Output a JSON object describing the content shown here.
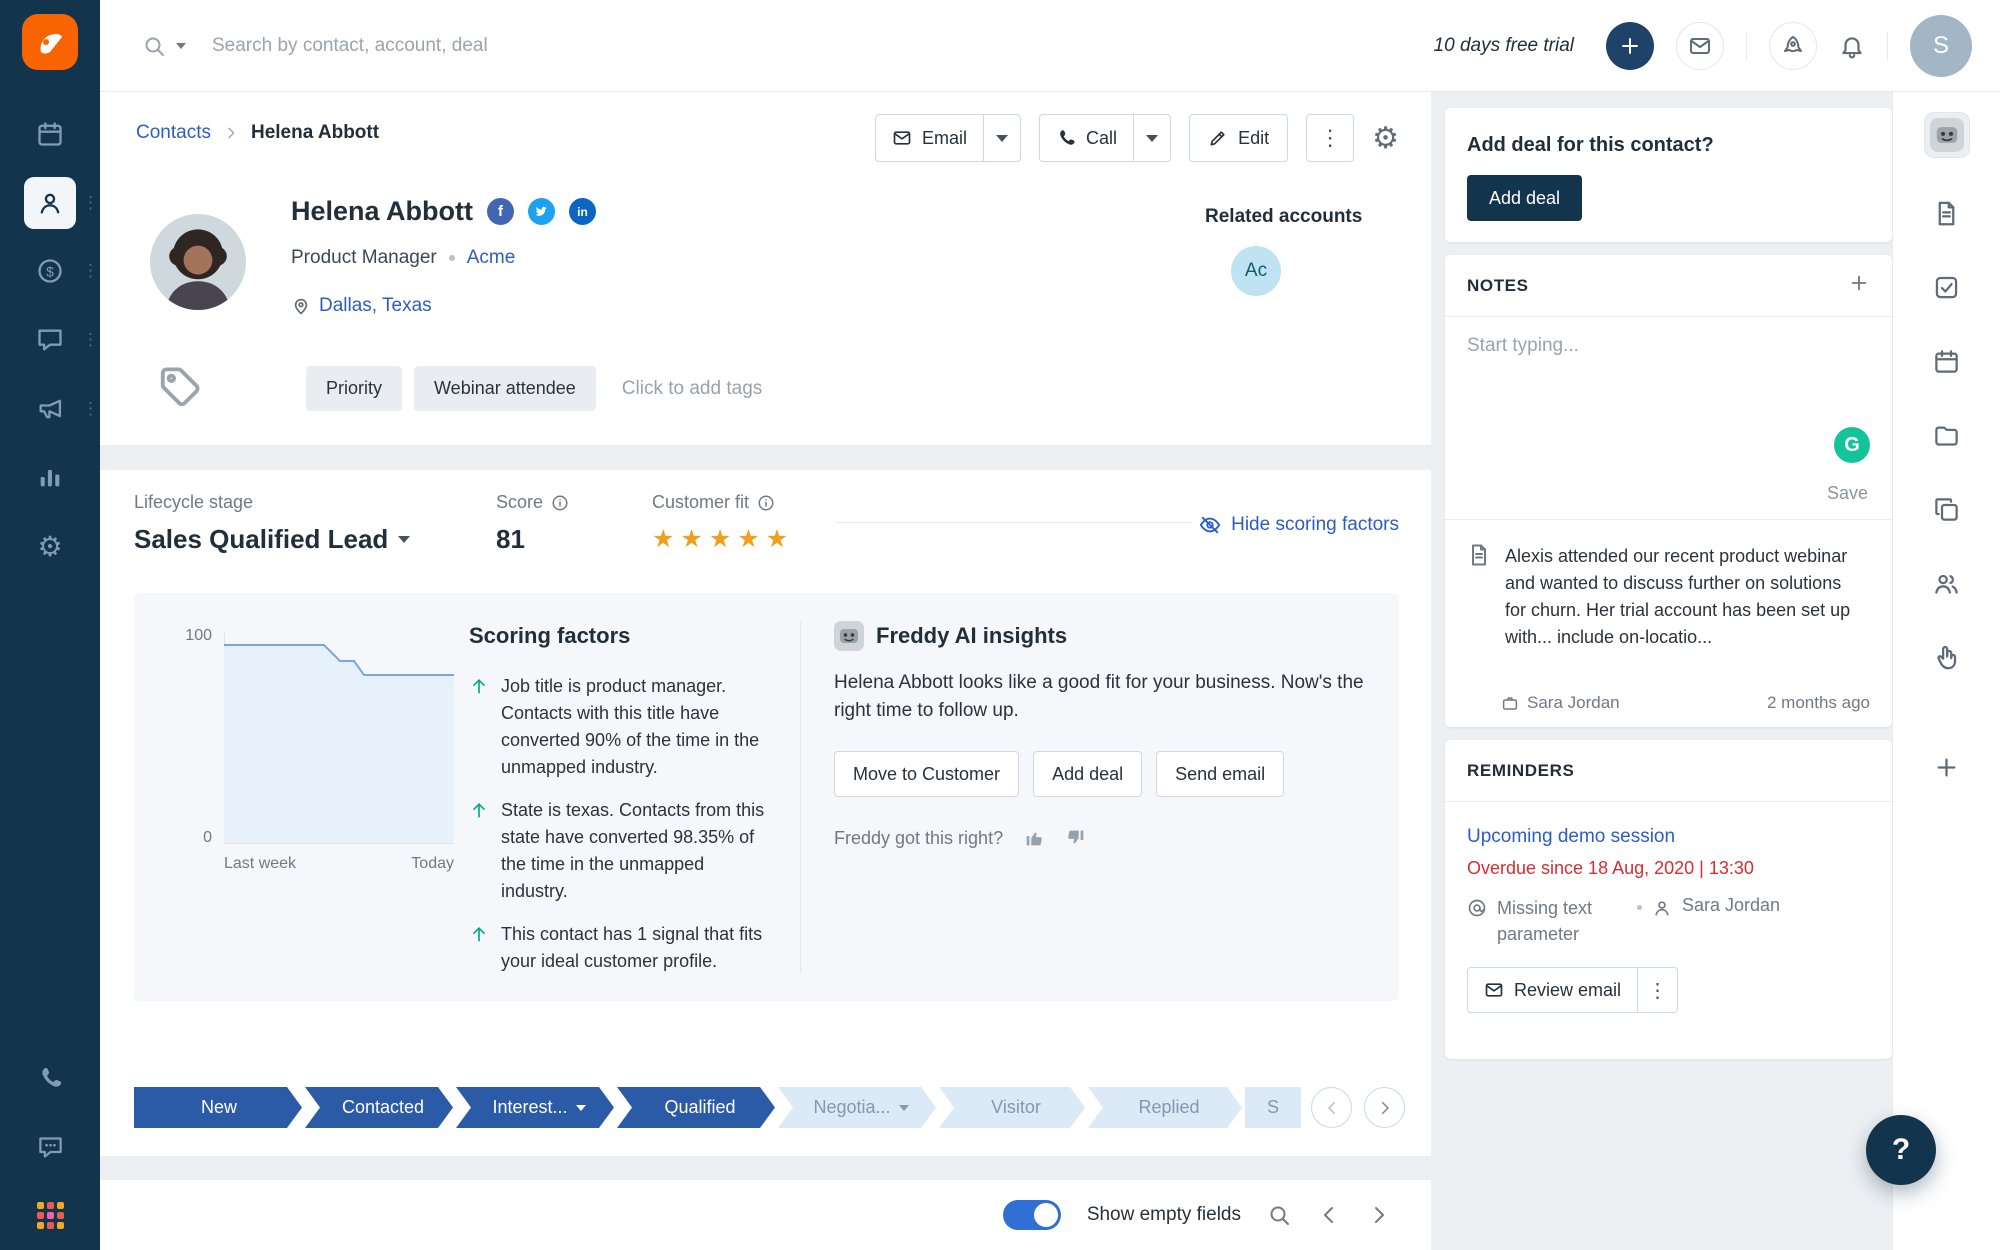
{
  "colors": {
    "sidebar_navy": "#12344d",
    "accent_blue": "#2c5cc5",
    "brand_orange": "#f96400",
    "star_orange": "#efa01e",
    "positive_green": "#00a886",
    "overdue_red": "#d72d30",
    "pipeline_active": "#2b5aa7"
  },
  "topbar": {
    "search_placeholder": "Search by contact, account, deal",
    "trial_text": "10 days free trial",
    "avatar_initial": "S"
  },
  "breadcrumb": {
    "root": "Contacts",
    "current": "Helena Abbott"
  },
  "actions": {
    "email_label": "Email",
    "call_label": "Call",
    "edit_label": "Edit"
  },
  "contact": {
    "name": "Helena Abbott",
    "job_title": "Product Manager",
    "company": "Acme",
    "location": "Dallas, Texas",
    "tags": [
      "Priority",
      "Webinar attendee"
    ],
    "add_tag_placeholder": "Click to add tags",
    "related_accounts_label": "Related accounts",
    "related_account_initials": "Ac"
  },
  "lifecycle": {
    "label": "Lifecycle stage",
    "value": "Sales Qualified Lead",
    "score_label": "Score",
    "score_value": "81",
    "fit_label": "Customer fit",
    "hide_link": "Hide scoring factors"
  },
  "scoring": {
    "heading": "Scoring factors",
    "factors": [
      "Job title is product manager. Contacts with this title have converted 90% of the time in the unmapped industry.",
      "State is texas. Contacts from this state have converted 98.35% of the time in the unmapped industry.",
      "This contact has 1 signal that fits your ideal customer profile."
    ],
    "chart": {
      "y_max": "100",
      "y_min": "0",
      "x_left": "Last week",
      "x_right": "Today"
    }
  },
  "freddy": {
    "heading": "Freddy AI insights",
    "message": "Helena Abbott looks like a good fit for your business. Now's the right time to follow up.",
    "buttons": {
      "move": "Move to Customer",
      "add_deal": "Add deal",
      "send_email": "Send email"
    },
    "feedback_prompt": "Freddy got this right?"
  },
  "pipeline": {
    "stages": [
      {
        "label": "New",
        "active": true
      },
      {
        "label": "Contacted",
        "active": true
      },
      {
        "label": "Interest...",
        "active": true,
        "has_dropdown": true
      },
      {
        "label": "Qualified",
        "active": true
      },
      {
        "label": "Negotia...",
        "active": false,
        "has_dropdown": true
      },
      {
        "label": "Visitor",
        "active": false
      },
      {
        "label": "Replied",
        "active": false
      },
      {
        "label": "S",
        "active": false
      }
    ]
  },
  "footer": {
    "show_empty_label": "Show empty fields"
  },
  "panel": {
    "add_deal": {
      "question": "Add deal for this contact?",
      "button_label": "Add deal"
    },
    "notes": {
      "heading": "NOTES",
      "placeholder": "Start typing...",
      "save_label": "Save",
      "grammarly_letter": "G",
      "note": {
        "text": "Alexis attended our recent product webinar and wanted to discuss further on solutions for churn. Her trial account has been set up with... include on-locatio...",
        "author": "Sara Jordan",
        "time": "2 months ago"
      }
    },
    "reminders": {
      "heading": "REMINDERS",
      "title": "Upcoming demo session",
      "overdue": "Overdue since 18 Aug, 2020 | 13:30",
      "issue": "Missing text parameter",
      "owner": "Sara Jordan",
      "review_button_label": "Review email"
    }
  },
  "help": {
    "label": "?"
  },
  "icons": {
    "facebook": "f",
    "linkedin": "in"
  },
  "chart_data": {
    "type": "line",
    "title": "Lead score trend",
    "x_range": [
      "Last week",
      "Today"
    ],
    "ylim": [
      0,
      100
    ],
    "series": [
      {
        "name": "Score",
        "values": [
          95,
          95,
          95,
          95,
          88,
          82,
          81
        ]
      }
    ],
    "grid": false,
    "legend": false
  }
}
